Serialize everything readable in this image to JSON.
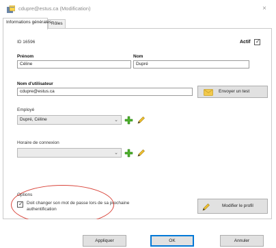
{
  "window": {
    "title": "cdupre@estus.ca (Modification)",
    "close_glyph": "×"
  },
  "tabs": [
    {
      "label": "Informations générales",
      "active": true
    },
    {
      "label": "Rôles",
      "active": false
    }
  ],
  "general": {
    "id_text": "ID 16596",
    "actif_label": "Actif",
    "actif_checked": true,
    "prenom_label": "Prénom",
    "prenom_value": "Céline",
    "nom_label": "Nom",
    "nom_value": "Dupré",
    "username_label": "Nom d'utilisateur",
    "username_value": "cdupre@estus.ca",
    "send_test_label": "Envoyer un test",
    "employe_label": "Employé",
    "employe_value": "Dupré, Céline",
    "horaire_label": "Horaire de connexion",
    "horaire_value": "",
    "options_label": "Options",
    "must_change_pw_label_line1": "Doit changer son mot de passe lors de sa prochaine",
    "must_change_pw_label_line2": "authentification",
    "must_change_pw_checked": true,
    "modify_profile_label": "Modifier le profil"
  },
  "footer": {
    "apply_label": "Appliquer",
    "ok_label": "OK",
    "cancel_label": "Annuler"
  },
  "colors": {
    "accent": "#0078d7",
    "highlight_ellipse": "#d9443a",
    "plus_green": "#4caf2a",
    "pencil_yellow": "#f2c230"
  },
  "icons": {
    "window": "user-app-icon",
    "send_test": "envelope-icon",
    "add": "plus-icon",
    "edit": "pencil-icon",
    "dropdown": "chevron-down-icon"
  }
}
